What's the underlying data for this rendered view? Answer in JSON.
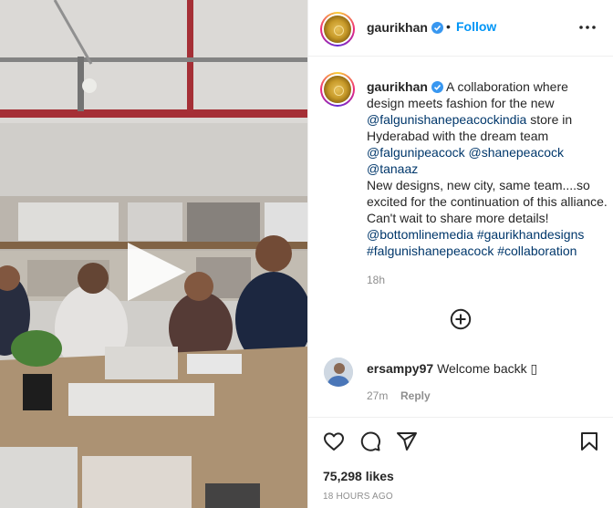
{
  "post": {
    "username": "gaurikhan",
    "dot": "•",
    "follow_label": "Follow",
    "more_icon": "more-horizontal-icon",
    "verified_icon": "verified-badge-icon",
    "play_icon": "play-icon"
  },
  "caption": {
    "username": "gaurikhan",
    "text_1": "A collaboration where design meets fashion for the new",
    "mention_store": "@falgunishanepeacockindia",
    "text_2": "store in Hyderabad with the dream team",
    "mention_1": "@falgunipeacock",
    "mention_2": "@shanepeacock",
    "mention_3": "@tanaaz",
    "text_3": "New designs, new city, same team....so excited for the continuation of this alliance. Can't wait to share more details!",
    "mention_4": "@bottomlinemedia",
    "hashtag_1": "#gaurikhandesigns",
    "hashtag_2": "#falgunishanepeacock",
    "hashtag_3": "#collaboration",
    "time_ago": "18h",
    "load_more_icon": "plus-circle-icon"
  },
  "comment": {
    "username": "ersampy97",
    "text": "Welcome backk",
    "emoji": "▯",
    "time": "27m",
    "reply_label": "Reply"
  },
  "actions": {
    "like_icon": "heart-icon",
    "comment_icon": "comment-icon",
    "share_icon": "send-icon",
    "save_icon": "bookmark-icon",
    "likes": "75,298 likes",
    "posted": "18 HOURS AGO"
  },
  "colors": {
    "link": "#00376b",
    "follow": "#0095f6",
    "secondary_text": "#8e8e8e",
    "verified": "#3897f0"
  }
}
